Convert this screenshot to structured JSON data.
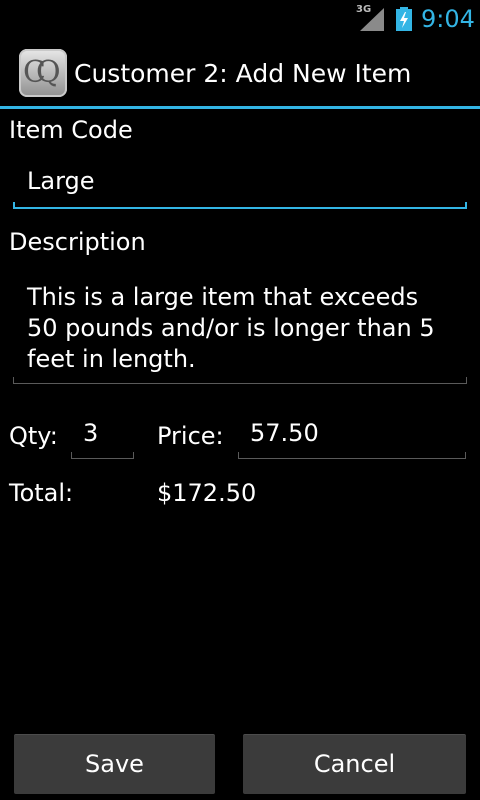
{
  "status_bar": {
    "network": "3G",
    "time": "9:04",
    "icons": [
      "signal-icon",
      "battery-charging-icon"
    ],
    "accent_color": "#33b5e5"
  },
  "title_bar": {
    "app_icon_text": "CQ",
    "title": "Customer 2: Add New Item"
  },
  "form": {
    "item_code": {
      "label": "Item Code",
      "value": "Large"
    },
    "description": {
      "label": "Description",
      "value": "This is a large item that exceeds 50 pounds and/or is longer than 5 feet in length."
    },
    "qty": {
      "label": "Qty:",
      "value": "3"
    },
    "price": {
      "label": "Price:",
      "value": "57.50"
    },
    "total": {
      "label": "Total:",
      "value": "$172.50"
    }
  },
  "buttons": {
    "save": "Save",
    "cancel": "Cancel"
  }
}
